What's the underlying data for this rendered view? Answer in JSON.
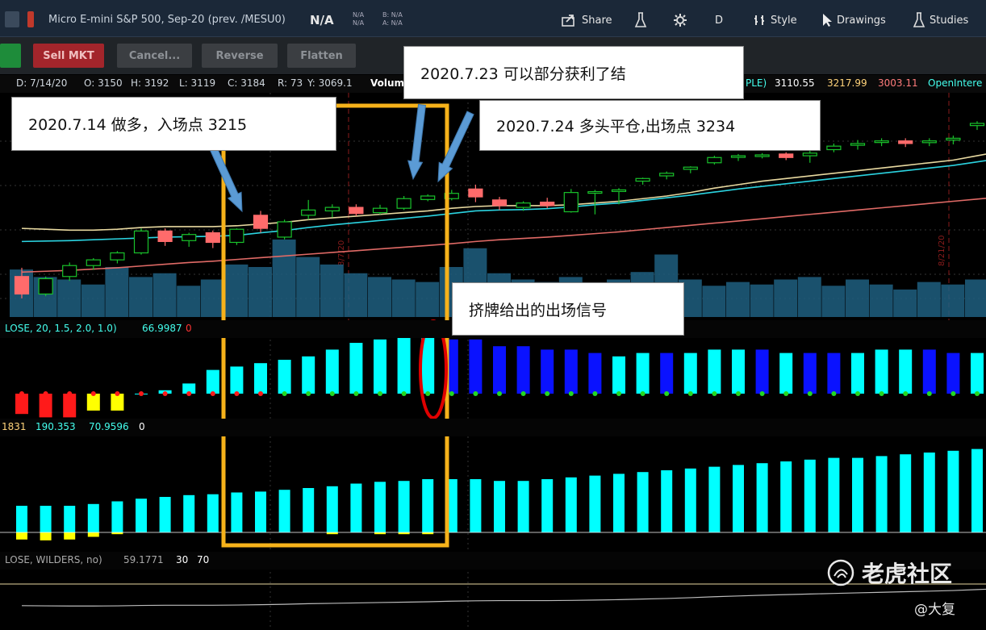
{
  "header": {
    "symbol": "Micro E-mini S&P 500, Sep-20 (prev. /MESU0)",
    "price": "N/A",
    "na_top": "N/A",
    "na_bottom": "N/A",
    "bid": "B: N/A",
    "ask": "A: N/A",
    "share_label": "Share",
    "period_label": "D",
    "style_label": "Style",
    "drawings_label": "Drawings",
    "studies_label": "Studies"
  },
  "order_bar": {
    "sell_label": "Sell MKT",
    "cancel_label": "Cancel...",
    "reverse_label": "Reverse",
    "flatten_label": "Flatten"
  },
  "info_bar": {
    "date": "D: 7/14/20",
    "open": "O: 3150",
    "high": "H: 3192",
    "low": "L: 3119",
    "close": "C: 3184",
    "range": "R: 73",
    "y": "Y: 3069.1",
    "volume_label": "Volum",
    "ple": "PLE)",
    "v1": "3110.55",
    "v2": "3217.99",
    "v3": "3003.11",
    "oi": "OpenIntere"
  },
  "squeeze_head": {
    "params": "LOSE, 20, 1.5, 2.0, 1.0)",
    "value": "66.9987",
    "zero": "0"
  },
  "momentum_head": {
    "v1": "1831",
    "v2": "190.353",
    "v3": "70.9596",
    "zero": "0"
  },
  "rsi_head": {
    "params": "LOSE, WILDERS, no)",
    "value": "59.1771",
    "lo": "30",
    "hi": "70"
  },
  "callouts": {
    "entry": "2020.7.14  做多，入场点 3215",
    "partial": "2020.7.23  可以部分获利了结",
    "exit": "2020.7.24  多头平仓,出场点 3234",
    "signal": "挤牌给出的出场信号"
  },
  "date_marks": [
    "8/7/20",
    "8/21/20"
  ],
  "watermark": {
    "brand": "老虎社区",
    "author": "@大复"
  },
  "colors": {
    "up": "#19c22b",
    "down": "#ff6b6b",
    "cyan": "#00ffff",
    "blue": "#0a12ff",
    "box": "#f6b21a",
    "circle": "#e00000"
  },
  "chart_data": {
    "type": "candlestick",
    "candles": [
      {
        "o": 3040,
        "h": 3060,
        "l": 2990,
        "c": 3000
      },
      {
        "o": 3000,
        "h": 3040,
        "l": 2995,
        "c": 3035
      },
      {
        "o": 3040,
        "h": 3072,
        "l": 3030,
        "c": 3065
      },
      {
        "o": 3065,
        "h": 3082,
        "l": 3055,
        "c": 3078
      },
      {
        "o": 3078,
        "h": 3098,
        "l": 3070,
        "c": 3094
      },
      {
        "o": 3094,
        "h": 3150,
        "l": 3090,
        "c": 3144
      },
      {
        "o": 3144,
        "h": 3150,
        "l": 3110,
        "c": 3120
      },
      {
        "o": 3122,
        "h": 3140,
        "l": 3108,
        "c": 3136
      },
      {
        "o": 3140,
        "h": 3145,
        "l": 3105,
        "c": 3118
      },
      {
        "o": 3118,
        "h": 3150,
        "l": 3112,
        "c": 3148
      },
      {
        "o": 3180,
        "h": 3190,
        "l": 3140,
        "c": 3150
      },
      {
        "o": 3130,
        "h": 3170,
        "l": 3125,
        "c": 3165
      },
      {
        "o": 3180,
        "h": 3215,
        "l": 3170,
        "c": 3192
      },
      {
        "o": 3190,
        "h": 3205,
        "l": 3175,
        "c": 3198
      },
      {
        "o": 3198,
        "h": 3205,
        "l": 3178,
        "c": 3184
      },
      {
        "o": 3186,
        "h": 3204,
        "l": 3182,
        "c": 3196
      },
      {
        "o": 3196,
        "h": 3224,
        "l": 3192,
        "c": 3218
      },
      {
        "o": 3216,
        "h": 3228,
        "l": 3212,
        "c": 3224
      },
      {
        "o": 3218,
        "h": 3238,
        "l": 3214,
        "c": 3230
      },
      {
        "o": 3240,
        "h": 3250,
        "l": 3210,
        "c": 3222
      },
      {
        "o": 3215,
        "h": 3222,
        "l": 3192,
        "c": 3202
      },
      {
        "o": 3198,
        "h": 3212,
        "l": 3190,
        "c": 3208
      },
      {
        "o": 3210,
        "h": 3220,
        "l": 3196,
        "c": 3202
      },
      {
        "o": 3188,
        "h": 3240,
        "l": 3186,
        "c": 3232
      },
      {
        "o": 3232,
        "h": 3238,
        "l": 3182,
        "c": 3234
      },
      {
        "o": 3238,
        "h": 3242,
        "l": 3205,
        "c": 3238
      },
      {
        "o": 3258,
        "h": 3266,
        "l": 3250,
        "c": 3264
      },
      {
        "o": 3270,
        "h": 3280,
        "l": 3262,
        "c": 3276
      },
      {
        "o": 3285,
        "h": 3292,
        "l": 3276,
        "c": 3290
      },
      {
        "o": 3300,
        "h": 3316,
        "l": 3296,
        "c": 3312
      },
      {
        "o": 3314,
        "h": 3320,
        "l": 3304,
        "c": 3316
      },
      {
        "o": 3318,
        "h": 3322,
        "l": 3310,
        "c": 3318
      },
      {
        "o": 3320,
        "h": 3324,
        "l": 3306,
        "c": 3312
      },
      {
        "o": 3316,
        "h": 3330,
        "l": 3300,
        "c": 3322
      },
      {
        "o": 3330,
        "h": 3344,
        "l": 3324,
        "c": 3338
      },
      {
        "o": 3340,
        "h": 3352,
        "l": 3330,
        "c": 3344
      },
      {
        "o": 3348,
        "h": 3356,
        "l": 3338,
        "c": 3350
      },
      {
        "o": 3350,
        "h": 3356,
        "l": 3336,
        "c": 3344
      },
      {
        "o": 3346,
        "h": 3356,
        "l": 3338,
        "c": 3350
      },
      {
        "o": 3352,
        "h": 3362,
        "l": 3342,
        "c": 3356
      },
      {
        "o": 3385,
        "h": 3395,
        "l": 3375,
        "c": 3390
      },
      {
        "o": 3392,
        "h": 3410,
        "l": 3385,
        "c": 3405
      }
    ],
    "volume": [
      38,
      32,
      30,
      26,
      40,
      32,
      35,
      25,
      30,
      42,
      40,
      62,
      48,
      42,
      35,
      32,
      30,
      28,
      40,
      55,
      35,
      30,
      28,
      32,
      26,
      30,
      36,
      50,
      30,
      25,
      28,
      26,
      30,
      32,
      25,
      30,
      26,
      22,
      28,
      26,
      30,
      35
    ],
    "sma_slow": [
      3050,
      3052,
      3054,
      3057,
      3060,
      3064,
      3068,
      3072,
      3075,
      3079,
      3083,
      3087,
      3091,
      3095,
      3099,
      3103,
      3107,
      3111,
      3115,
      3120,
      3124,
      3127,
      3130,
      3134,
      3138,
      3142,
      3147,
      3152,
      3157,
      3162,
      3167,
      3172,
      3177,
      3182,
      3187,
      3192,
      3197,
      3202,
      3207,
      3212,
      3217,
      3222
    ],
    "ema_mid": [
      3120,
      3121,
      3122,
      3124,
      3126,
      3128,
      3130,
      3131,
      3132,
      3134,
      3140,
      3145,
      3152,
      3158,
      3163,
      3168,
      3173,
      3178,
      3184,
      3190,
      3192,
      3193,
      3195,
      3199,
      3204,
      3208,
      3214,
      3220,
      3226,
      3233,
      3240,
      3246,
      3252,
      3258,
      3264,
      3270,
      3276,
      3282,
      3288,
      3294,
      3302,
      3310
    ],
    "ema_fast": [
      3150,
      3148,
      3146,
      3146,
      3148,
      3152,
      3154,
      3154,
      3154,
      3156,
      3160,
      3164,
      3170,
      3174,
      3178,
      3182,
      3186,
      3190,
      3196,
      3200,
      3202,
      3202,
      3202,
      3204,
      3208,
      3212,
      3218,
      3224,
      3232,
      3242,
      3250,
      3258,
      3264,
      3270,
      3276,
      3282,
      3288,
      3294,
      3300,
      3306,
      3316,
      3326
    ],
    "squeeze": {
      "values": [
        -6,
        -7,
        -7,
        -5,
        -5,
        0,
        1,
        3,
        7,
        8,
        9,
        10,
        11,
        13,
        15,
        16,
        17,
        18,
        16,
        16,
        14,
        14,
        13,
        13,
        12,
        11,
        12,
        12,
        12,
        13,
        13,
        13,
        12,
        12,
        12,
        12,
        13,
        13,
        13,
        12,
        12,
        12
      ],
      "colors": [
        "red",
        "red",
        "red",
        "yellow",
        "yellow",
        "cyan",
        "cyan",
        "cyan",
        "cyan",
        "cyan",
        "cyan",
        "cyan",
        "cyan",
        "cyan",
        "cyan",
        "cyan",
        "cyan",
        "cyan",
        "blue",
        "blue",
        "blue",
        "blue",
        "blue",
        "blue",
        "blue",
        "cyan",
        "cyan",
        "blue",
        "cyan",
        "cyan",
        "cyan",
        "blue",
        "cyan",
        "blue",
        "blue",
        "cyan",
        "cyan",
        "cyan",
        "blue",
        "blue",
        "cyan",
        "cyan"
      ],
      "dots": [
        "red",
        "red",
        "red",
        "red",
        "red",
        "red",
        "red",
        "red",
        "red",
        "red",
        "red",
        "green",
        "green",
        "green",
        "green",
        "green",
        "green",
        "green",
        "green",
        "green",
        "green",
        "green",
        "green",
        "green",
        "green",
        "green",
        "green",
        "green",
        "green",
        "green",
        "green",
        "green",
        "green",
        "green",
        "green",
        "green",
        "green",
        "green",
        "green",
        "green",
        "green",
        "green"
      ]
    },
    "momentum": {
      "values": [
        30,
        30,
        30,
        32,
        35,
        38,
        40,
        42,
        43,
        45,
        46,
        48,
        50,
        52,
        55,
        57,
        58,
        60,
        60,
        60,
        58,
        58,
        60,
        62,
        64,
        66,
        68,
        70,
        72,
        74,
        76,
        78,
        80,
        82,
        84,
        84,
        86,
        88,
        90,
        92,
        94,
        96
      ],
      "neg": [
        -8,
        -9,
        -8,
        -5,
        -2,
        0,
        0,
        0,
        0,
        0,
        0,
        0,
        0,
        -2,
        0,
        -2,
        -2,
        -2,
        0,
        0,
        0,
        0,
        0,
        0,
        0,
        0,
        0,
        0,
        0,
        0,
        0,
        0,
        0,
        0,
        0,
        0,
        0,
        0,
        0,
        0,
        0,
        0
      ]
    }
  }
}
